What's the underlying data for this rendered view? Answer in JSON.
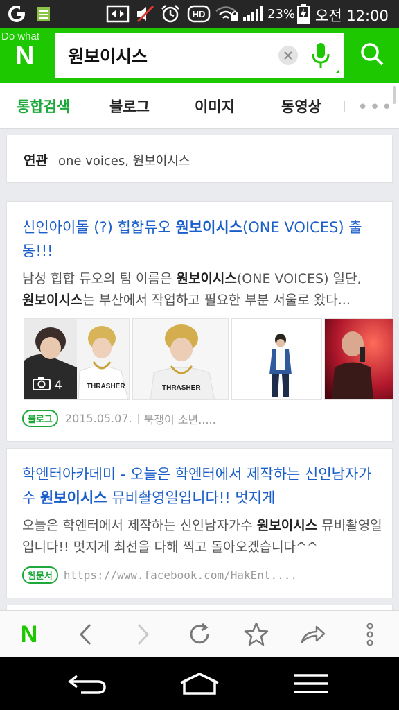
{
  "status_bar": {
    "battery_percent": "23%",
    "time": "오전 12:00",
    "icons": [
      "g-logo-icon",
      "notes-icon",
      "screen-mirror-icon",
      "mute-icon",
      "alarm-icon",
      "hd-voice-icon",
      "wifi-lock-icon",
      "signal-icon",
      "battery-charging-icon"
    ]
  },
  "header": {
    "logo": "N",
    "overlay_text": "Do what",
    "search_value": "원보이시스",
    "icons": [
      "clear-icon",
      "mic-icon",
      "search-icon"
    ]
  },
  "tabs": {
    "items": [
      "통합검색",
      "블로그",
      "이미지",
      "동영상"
    ],
    "active": "통합검색",
    "more": "•••"
  },
  "related": {
    "label": "연관",
    "items": "one voices, 원보이시스"
  },
  "results": [
    {
      "title_pre": "신인아이돌 (?) 힙합듀오 ",
      "title_hl": "원보이시스",
      "title_post": "(ONE VOICES) 출동!!!",
      "desc_line1_pre": "남성 힙합 듀오의 팀 이름은 ",
      "desc_line1_hl": "원보이시스",
      "desc_line1_post": "(ONE VOICES) 일단,",
      "desc_line2_hl": "원보이시스",
      "desc_line2_post": "는 부산에서 작업하고 필요한 부분 서울로 왔다...",
      "photo_count": "4",
      "badge": "블로그",
      "date": "2015.05.07.",
      "source": "북쟁이 소년....."
    },
    {
      "title_pre": "학엔터아카데미 - 오늘은 학엔터에서 제작하는 신인남자가수 ",
      "title_hl": "원보이시스",
      "title_post": " 뮤비촬영일입니다!! 멋지게",
      "desc_pre": "오늘은 학엔터에서 제작하는 신인남자가수 ",
      "desc_hl": "원보이시스",
      "desc_post": " 뮤비촬영일입니다!! 멋지게 최선을 다해 찍고 돌아오겠습니다^^",
      "badge": "웹문서",
      "url": "https://www.facebook.com/HakEnt...."
    }
  ],
  "toolbar": {
    "home_logo": "N",
    "icons": [
      "naver-home-icon",
      "back-icon",
      "forward-icon",
      "refresh-icon",
      "bookmark-star-icon",
      "share-icon",
      "more-vert-icon"
    ]
  },
  "nav_bar": {
    "icons": [
      "android-back-icon",
      "android-home-icon",
      "android-menu-icon"
    ]
  },
  "colors": {
    "brand_green": "#1ec800",
    "link_blue": "#1a5ec9",
    "tab_active_green": "#1ea83a"
  }
}
